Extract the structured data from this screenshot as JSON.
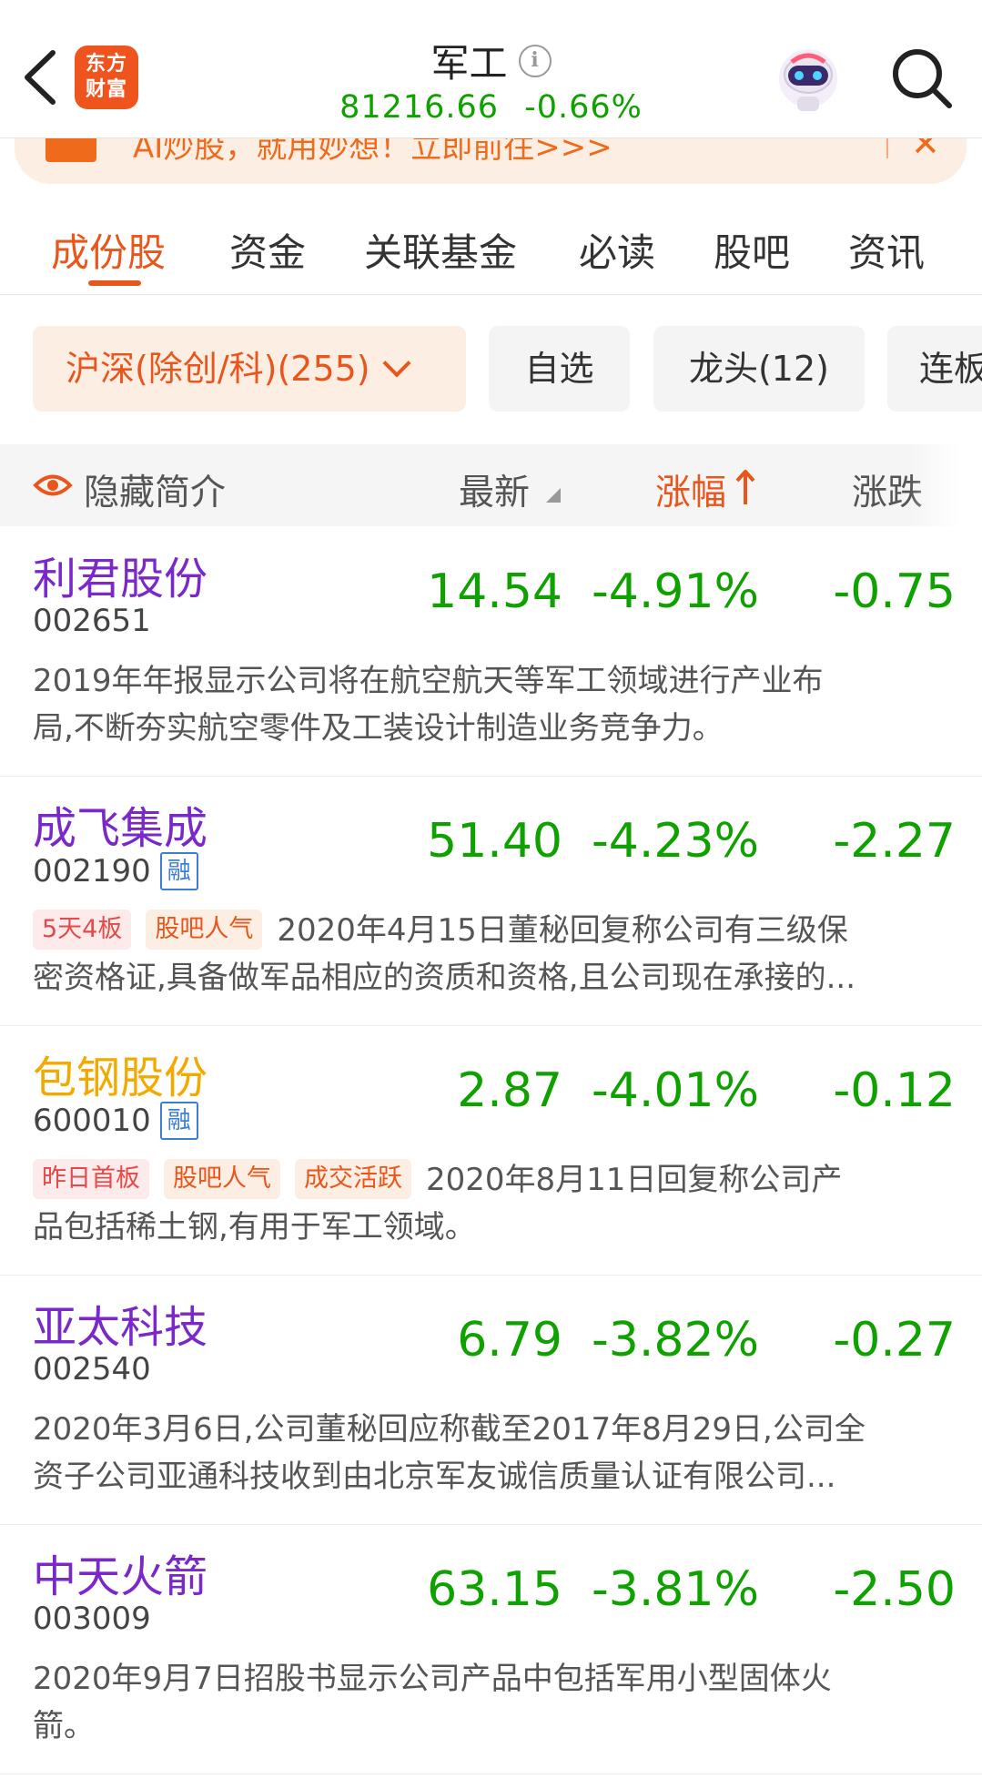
{
  "header": {
    "logo_text_line1": "东方",
    "logo_text_line2": "财富",
    "title": "军工",
    "index_value": "81216.66",
    "index_change": "-0.66%"
  },
  "banner": {
    "text": "AI炒股，就用妙想！立即前往>>>"
  },
  "tabs": [
    {
      "label": "成份股"
    },
    {
      "label": "资金"
    },
    {
      "label": "关联基金"
    },
    {
      "label": "必读"
    },
    {
      "label": "股吧"
    },
    {
      "label": "资讯"
    }
  ],
  "filters": [
    {
      "label": "沪深(除创/科)(255)"
    },
    {
      "label": "自选"
    },
    {
      "label": "龙头(12)"
    },
    {
      "label": "连板"
    }
  ],
  "list_header": {
    "hide_intro": "隐藏简介",
    "latest": "最新",
    "change_pct": "涨幅",
    "change": "涨跌"
  },
  "stocks": [
    {
      "name": "利君股份",
      "code": "002651",
      "price": "14.54",
      "pct": "-4.91%",
      "chg": "-0.75",
      "desc1": "2019年年报显示公司将在航空航天等军工领域进行产业布",
      "desc2": "局,不断夯实航空零件及工装设计制造业务竞争力。"
    },
    {
      "name": "成飞集成",
      "code": "002190",
      "rong": "融",
      "price": "51.40",
      "pct": "-4.23%",
      "chg": "-2.27",
      "tag1": "5天4板",
      "tag2": "股吧人气",
      "desc1": "2020年4月15日董秘回复称公司有三级保",
      "desc2": "密资格证,具备做军品相应的资质和资格,且公司现在承接的..."
    },
    {
      "name": "包钢股份",
      "code": "600010",
      "rong": "融",
      "price": "2.87",
      "pct": "-4.01%",
      "chg": "-0.12",
      "tag1": "昨日首板",
      "tag2": "股吧人气",
      "tag3": "成交活跃",
      "desc1": "2020年8月11日回复称公司产",
      "desc2": "品包括稀土钢,有用于军工领域。"
    },
    {
      "name": "亚太科技",
      "code": "002540",
      "price": "6.79",
      "pct": "-3.82%",
      "chg": "-0.27",
      "desc1": "2020年3月6日,公司董秘回应称截至2017年8月29日,公司全",
      "desc2": "资子公司亚通科技收到由北京军友诚信质量认证有限公司..."
    },
    {
      "name": "中天火箭",
      "code": "003009",
      "price": "63.15",
      "pct": "-3.81%",
      "chg": "-2.50",
      "desc1": "2020年9月7日招股书显示公司产品中包括军用小型固体火",
      "desc2": "箭。"
    }
  ],
  "colors": {
    "accent": "#e8561b",
    "down_green": "#0ea100",
    "name_purple": "#7a28c8",
    "name_yellow": "#f2a900"
  }
}
